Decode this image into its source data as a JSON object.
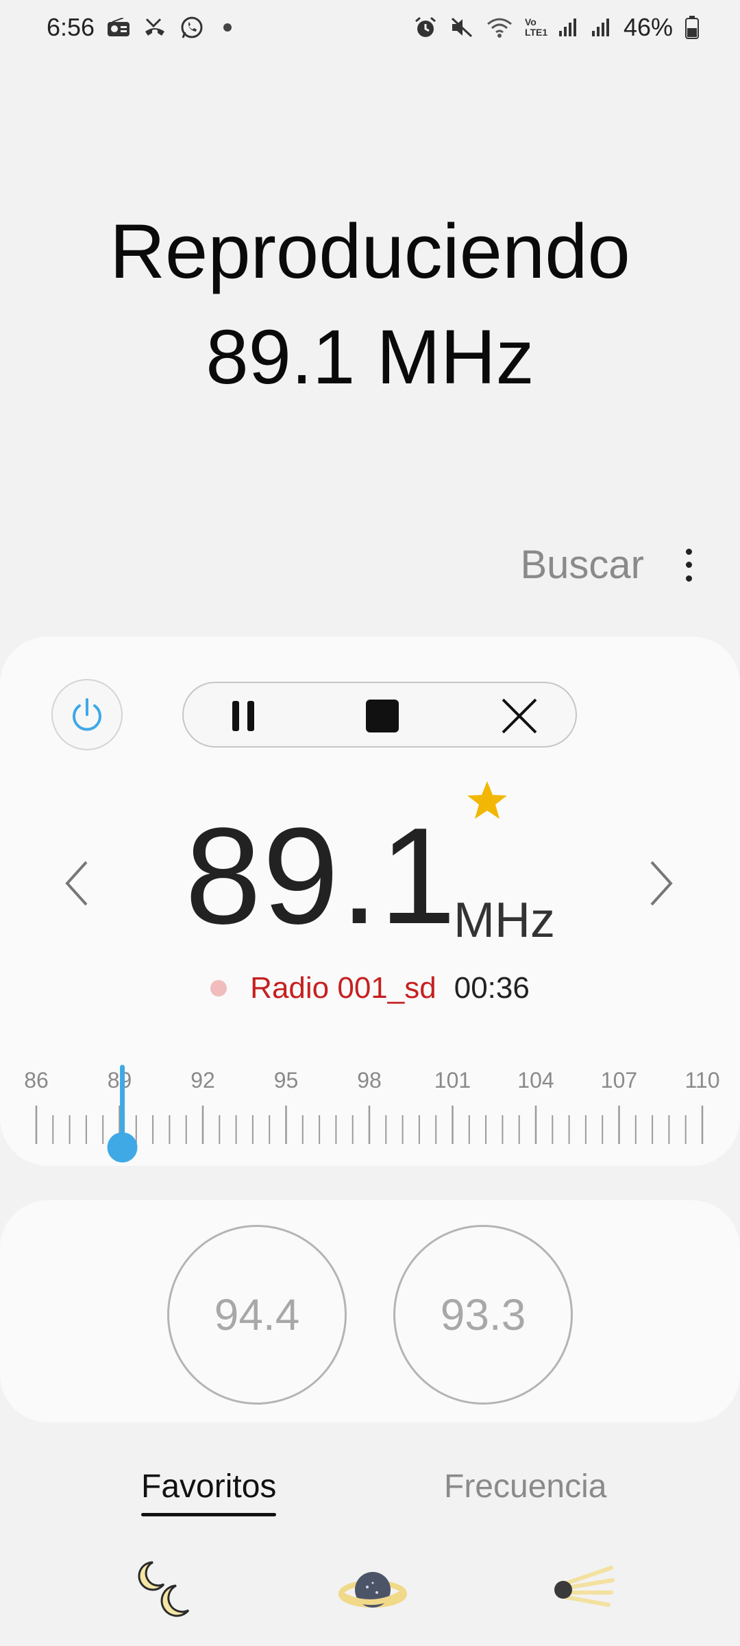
{
  "status_bar": {
    "time": "6:56",
    "battery": "46%",
    "network": "Vo LTE1"
  },
  "now_playing": {
    "line1": "Reproduciendo",
    "line2": "89.1 MHz"
  },
  "actions": {
    "search_label": "Buscar",
    "more_icon": "more-vertical-icon"
  },
  "tuner": {
    "frequency": "89.1",
    "unit": "MHz",
    "favorite": true,
    "station_name": "Radio 001_sd",
    "elapsed": "00:36",
    "scale_labels": [
      "86",
      "89",
      "92",
      "95",
      "98",
      "101",
      "104",
      "107",
      "110"
    ],
    "scale_min": 86,
    "scale_max": 110,
    "current_value": 89.1,
    "accent_color": "#3fa9e6",
    "star_color": "#f2b705",
    "record_color": "#c62020"
  },
  "favorites": {
    "presets": [
      "94.4",
      "93.3"
    ]
  },
  "tabs": {
    "favorites": "Favoritos",
    "frequency": "Frecuencia"
  },
  "bottom_nav": {
    "icons": [
      "moon-icon",
      "planet-icon",
      "comet-icon"
    ]
  }
}
